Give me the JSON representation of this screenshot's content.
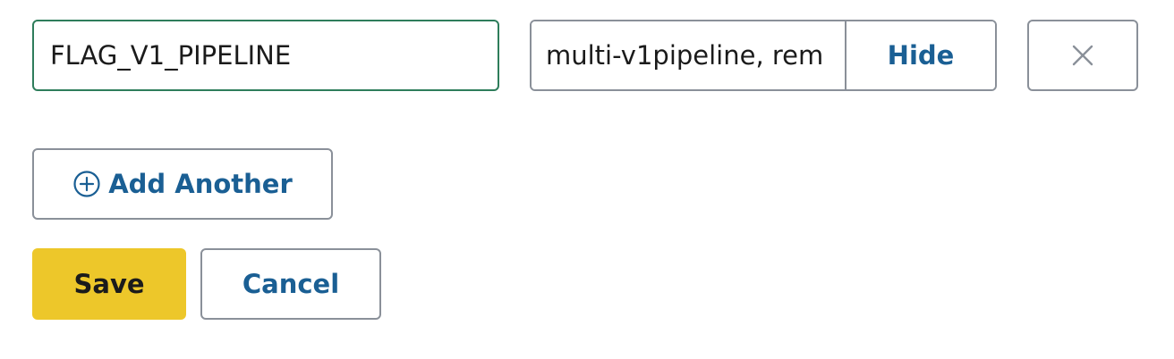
{
  "env_var": {
    "name_value": "FLAG_V1_PIPELINE",
    "value_value": "multi-v1pipeline, rem",
    "hide_label": "Hide",
    "remove_icon": "close-icon"
  },
  "actions": {
    "add_another_label": "Add Another",
    "add_icon": "plus-circle-icon",
    "save_label": "Save",
    "cancel_label": "Cancel"
  },
  "colors": {
    "accent_blue": "#1a5f94",
    "focus_green": "#2e7d5b",
    "save_yellow": "#edc72a",
    "border_gray": "#8a9099"
  }
}
